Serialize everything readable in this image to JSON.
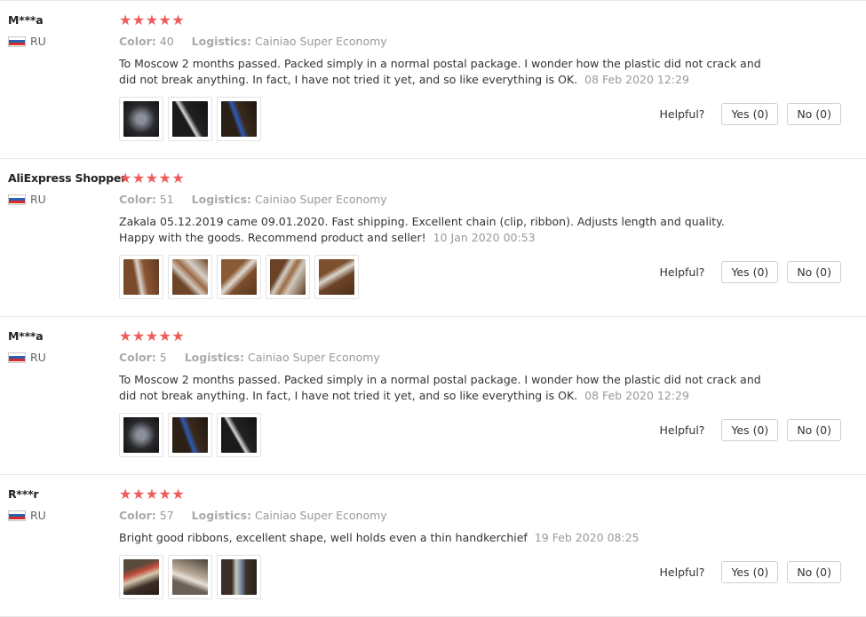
{
  "reviews": [
    {
      "user": "M***a",
      "country": "RU",
      "stars": 5,
      "color_label": "Color:",
      "color_value": "40",
      "logistics_label": "Logistics:",
      "logistics_value": "Cainiao Super Economy",
      "text": "To Moscow 2 months passed. Packed simply in a normal postal package. I wonder how the plastic did not crack and did not break anything. In fact, I have not tried it yet, and so like everything is OK.",
      "date": "08 Feb 2020 12:29",
      "thumb_count": 3,
      "helpful_label": "Helpful?",
      "yes_label": "Yes (0)",
      "no_label": "No (0)"
    },
    {
      "user": "AliExpress Shopper",
      "country": "RU",
      "stars": 5,
      "color_label": "Color:",
      "color_value": "51",
      "logistics_label": "Logistics:",
      "logistics_value": "Cainiao Super Economy",
      "text": "Zakala 05.12.2019 came 09.01.2020. Fast shipping. Excellent chain (clip, ribbon). Adjusts length and quality. Happy with the goods. Recommend product and seller!",
      "date": "10 Jan 2020 00:53",
      "thumb_count": 5,
      "helpful_label": "Helpful?",
      "yes_label": "Yes (0)",
      "no_label": "No (0)"
    },
    {
      "user": "M***a",
      "country": "RU",
      "stars": 5,
      "color_label": "Color:",
      "color_value": "5",
      "logistics_label": "Logistics:",
      "logistics_value": "Cainiao Super Economy",
      "text": "To Moscow 2 months passed. Packed simply in a normal postal package. I wonder how the plastic did not crack and did not break anything. In fact, I have not tried it yet, and so like everything is OK.",
      "date": "08 Feb 2020 12:29",
      "thumb_count": 3,
      "helpful_label": "Helpful?",
      "yes_label": "Yes (0)",
      "no_label": "No (0)"
    },
    {
      "user": "R***r",
      "country": "RU",
      "stars": 5,
      "color_label": "Color:",
      "color_value": "57",
      "logistics_label": "Logistics:",
      "logistics_value": "Cainiao Super Economy",
      "text": "Bright good ribbons, excellent shape, well holds even a thin handkerchief",
      "date": "19 Feb 2020 08:25",
      "thumb_count": 3,
      "helpful_label": "Helpful?",
      "yes_label": "Yes (0)",
      "no_label": "No (0)"
    }
  ],
  "colors": {
    "star": "#ef5b5b",
    "divider": "#e8e8e8",
    "muted_text": "#999999"
  }
}
